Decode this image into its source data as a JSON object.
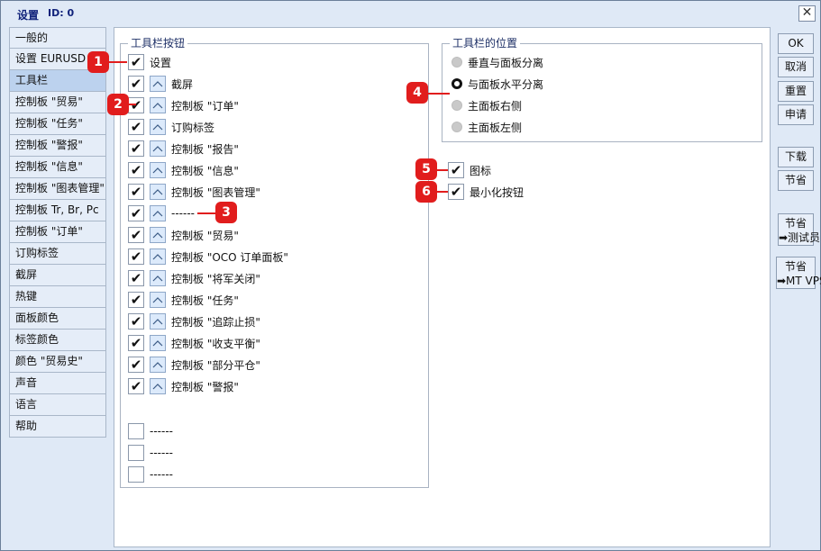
{
  "window": {
    "title": "设置",
    "id_label": "ID: 0",
    "close_glyph": "✕"
  },
  "sidebar": {
    "items": [
      {
        "label": "一般的"
      },
      {
        "label": "设置 EURUSD"
      },
      {
        "label": "工具栏"
      },
      {
        "label": "控制板 \"贸易\""
      },
      {
        "label": "控制板 \"任务\""
      },
      {
        "label": "控制板 \"警报\""
      },
      {
        "label": "控制板 \"信息\""
      },
      {
        "label": "控制板 \"图表管理\""
      },
      {
        "label": "控制板 Tr, Br, Pc"
      },
      {
        "label": "控制板 \"订单\""
      },
      {
        "label": "订购标签"
      },
      {
        "label": "截屏"
      },
      {
        "label": "热键"
      },
      {
        "label": "面板颜色"
      },
      {
        "label": "标签颜色"
      },
      {
        "label": "颜色 \"贸易史\""
      },
      {
        "label": "声音"
      },
      {
        "label": "语言"
      },
      {
        "label": "帮助"
      }
    ],
    "active_index": 2
  },
  "toolbar_buttons": {
    "title": "工具栏按钮",
    "items": [
      {
        "label": "设置",
        "checked": true,
        "arrow": false
      },
      {
        "label": "截屏",
        "checked": true,
        "arrow": true
      },
      {
        "label": "控制板 \"订单\"",
        "checked": true,
        "arrow": true
      },
      {
        "label": "订购标签",
        "checked": true,
        "arrow": true
      },
      {
        "label": "控制板 \"报告\"",
        "checked": true,
        "arrow": true
      },
      {
        "label": "控制板 \"信息\"",
        "checked": true,
        "arrow": true
      },
      {
        "label": "控制板 \"图表管理\"",
        "checked": true,
        "arrow": true
      },
      {
        "label": "------",
        "checked": true,
        "arrow": true
      },
      {
        "label": "控制板 \"贸易\"",
        "checked": true,
        "arrow": true
      },
      {
        "label": "控制板 \"OCO 订单面板\"",
        "checked": true,
        "arrow": true
      },
      {
        "label": "控制板 \"将军关闭\"",
        "checked": true,
        "arrow": true
      },
      {
        "label": "控制板 \"任务\"",
        "checked": true,
        "arrow": true
      },
      {
        "label": "控制板 \"追踪止损\"",
        "checked": true,
        "arrow": true
      },
      {
        "label": "控制板 \"收支平衡\"",
        "checked": true,
        "arrow": true
      },
      {
        "label": "控制板 \"部分平仓\"",
        "checked": true,
        "arrow": true
      },
      {
        "label": "控制板 \"警报\"",
        "checked": true,
        "arrow": true
      }
    ],
    "extra": [
      {
        "label": "------",
        "checked": false
      },
      {
        "label": "------",
        "checked": false
      },
      {
        "label": "------",
        "checked": false
      }
    ]
  },
  "toolbar_position": {
    "title": "工具栏的位置",
    "options": [
      {
        "label": "垂直与面板分离",
        "selected": false
      },
      {
        "label": "与面板水平分离",
        "selected": true
      },
      {
        "label": "主面板右侧",
        "selected": false
      },
      {
        "label": "主面板左侧",
        "selected": false
      }
    ]
  },
  "options": [
    {
      "label": "图标",
      "checked": true
    },
    {
      "label": "最小化按钮",
      "checked": true
    }
  ],
  "right_buttons": {
    "ok": "OK",
    "cancel": "取消",
    "reset": "重置",
    "apply": "申请",
    "download": "下载",
    "save": "节省",
    "save_tester_top": "节省",
    "save_tester_bottom": "➡测试员",
    "save_vps_top": "节省",
    "save_vps_bottom": "➡MT VPS"
  },
  "badges": [
    "1",
    "2",
    "3",
    "4",
    "5",
    "6"
  ],
  "colors": {
    "accent": "#10227a",
    "badge": "#e11d1d",
    "active_item": "#bcd2ee"
  },
  "check_glyph": "✔"
}
